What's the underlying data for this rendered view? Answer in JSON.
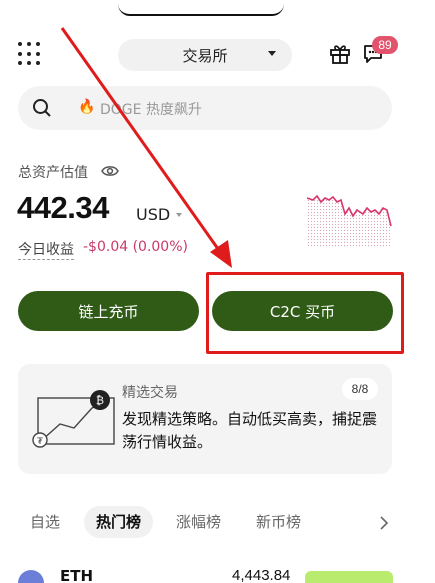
{
  "header": {
    "exchange_label": "交易所",
    "notification_count": "89"
  },
  "search": {
    "placeholder": "DOGE 热度飙升"
  },
  "assets": {
    "total_label": "总资产估值",
    "balance": "442.34",
    "currency": "USD",
    "today_label": "今日收益",
    "today_value": "-$0.04 (0.00%)"
  },
  "actions": {
    "deposit_label": "链上充币",
    "c2c_label": "C2C 买币"
  },
  "promo": {
    "title": "精选交易",
    "count": "8/8",
    "description": "发现精选策略。自动低买高卖，捕捉震荡行情收益。"
  },
  "market_tabs": [
    "自选",
    "热门榜",
    "涨幅榜",
    "新币榜"
  ],
  "market_rows": [
    {
      "name": "ETH",
      "price": "4,443.84"
    }
  ],
  "colors": {
    "primary_button": "#2f5b17",
    "badge": "#e2546c",
    "negative": "#c93a6a",
    "annotation": "#e01b1b"
  }
}
